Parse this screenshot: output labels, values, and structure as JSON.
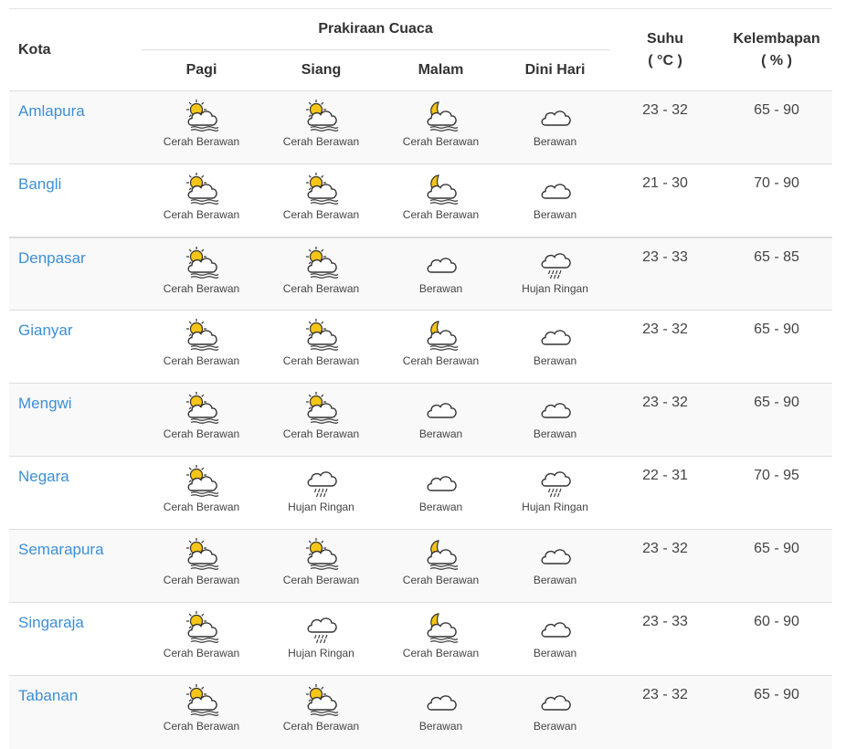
{
  "header": {
    "kota": "Kota",
    "forecast_group": "Prakiraan Cuaca",
    "periods": [
      "Pagi",
      "Siang",
      "Malam",
      "Dini Hari"
    ],
    "suhu": "Suhu",
    "suhu_unit": "( °C )",
    "kelembapan": "Kelembapan",
    "kelembapan_unit": "( % )"
  },
  "rows": [
    {
      "city": "Amlapura",
      "temp": "23 - 32",
      "humidity": "65 - 90",
      "forecast": [
        {
          "icon": "sun-cloud-haze-icon",
          "label": "Cerah Berawan"
        },
        {
          "icon": "sun-cloud-haze-icon",
          "label": "Cerah Berawan"
        },
        {
          "icon": "moon-cloud-haze-icon",
          "label": "Cerah Berawan"
        },
        {
          "icon": "cloud-icon",
          "label": "Berawan"
        }
      ]
    },
    {
      "city": "Bangli",
      "temp": "21 - 30",
      "humidity": "70 - 90",
      "forecast": [
        {
          "icon": "sun-cloud-haze-icon",
          "label": "Cerah Berawan"
        },
        {
          "icon": "sun-cloud-haze-icon",
          "label": "Cerah Berawan"
        },
        {
          "icon": "moon-cloud-haze-icon",
          "label": "Cerah Berawan"
        },
        {
          "icon": "cloud-icon",
          "label": "Berawan"
        }
      ]
    },
    {
      "city": "Denpasar",
      "temp": "23 - 33",
      "humidity": "65 - 85",
      "forecast": [
        {
          "icon": "sun-cloud-haze-icon",
          "label": "Cerah Berawan"
        },
        {
          "icon": "sun-cloud-haze-icon",
          "label": "Cerah Berawan"
        },
        {
          "icon": "cloud-icon",
          "label": "Berawan"
        },
        {
          "icon": "rain-cloud-icon",
          "label": "Hujan Ringan"
        }
      ]
    },
    {
      "city": "Gianyar",
      "temp": "23 - 32",
      "humidity": "65 - 90",
      "forecast": [
        {
          "icon": "sun-cloud-haze-icon",
          "label": "Cerah Berawan"
        },
        {
          "icon": "sun-cloud-haze-icon",
          "label": "Cerah Berawan"
        },
        {
          "icon": "moon-cloud-haze-icon",
          "label": "Cerah Berawan"
        },
        {
          "icon": "cloud-icon",
          "label": "Berawan"
        }
      ]
    },
    {
      "city": "Mengwi",
      "temp": "23 - 32",
      "humidity": "65 - 90",
      "forecast": [
        {
          "icon": "sun-cloud-haze-icon",
          "label": "Cerah Berawan"
        },
        {
          "icon": "sun-cloud-haze-icon",
          "label": "Cerah Berawan"
        },
        {
          "icon": "cloud-icon",
          "label": "Berawan"
        },
        {
          "icon": "cloud-icon",
          "label": "Berawan"
        }
      ]
    },
    {
      "city": "Negara",
      "temp": "22 - 31",
      "humidity": "70 - 95",
      "forecast": [
        {
          "icon": "sun-cloud-haze-icon",
          "label": "Cerah Berawan"
        },
        {
          "icon": "rain-cloud-icon",
          "label": "Hujan Ringan"
        },
        {
          "icon": "cloud-icon",
          "label": "Berawan"
        },
        {
          "icon": "rain-cloud-icon",
          "label": "Hujan Ringan"
        }
      ]
    },
    {
      "city": "Semarapura",
      "temp": "23 - 32",
      "humidity": "65 - 90",
      "forecast": [
        {
          "icon": "sun-cloud-haze-icon",
          "label": "Cerah Berawan"
        },
        {
          "icon": "sun-cloud-haze-icon",
          "label": "Cerah Berawan"
        },
        {
          "icon": "moon-cloud-haze-icon",
          "label": "Cerah Berawan"
        },
        {
          "icon": "cloud-icon",
          "label": "Berawan"
        }
      ]
    },
    {
      "city": "Singaraja",
      "temp": "23 - 33",
      "humidity": "60 - 90",
      "forecast": [
        {
          "icon": "sun-cloud-haze-icon",
          "label": "Cerah Berawan"
        },
        {
          "icon": "rain-cloud-icon",
          "label": "Hujan Ringan"
        },
        {
          "icon": "moon-cloud-haze-icon",
          "label": "Cerah Berawan"
        },
        {
          "icon": "cloud-icon",
          "label": "Berawan"
        }
      ]
    },
    {
      "city": "Tabanan",
      "temp": "23 - 32",
      "humidity": "65 - 90",
      "forecast": [
        {
          "icon": "sun-cloud-haze-icon",
          "label": "Cerah Berawan"
        },
        {
          "icon": "sun-cloud-haze-icon",
          "label": "Cerah Berawan"
        },
        {
          "icon": "cloud-icon",
          "label": "Berawan"
        },
        {
          "icon": "cloud-icon",
          "label": "Berawan"
        }
      ]
    }
  ],
  "colors": {
    "link": "#3d8fd6",
    "sun": "#f5c518",
    "row_alt": "#f9f9f9",
    "border": "#dddddd"
  }
}
